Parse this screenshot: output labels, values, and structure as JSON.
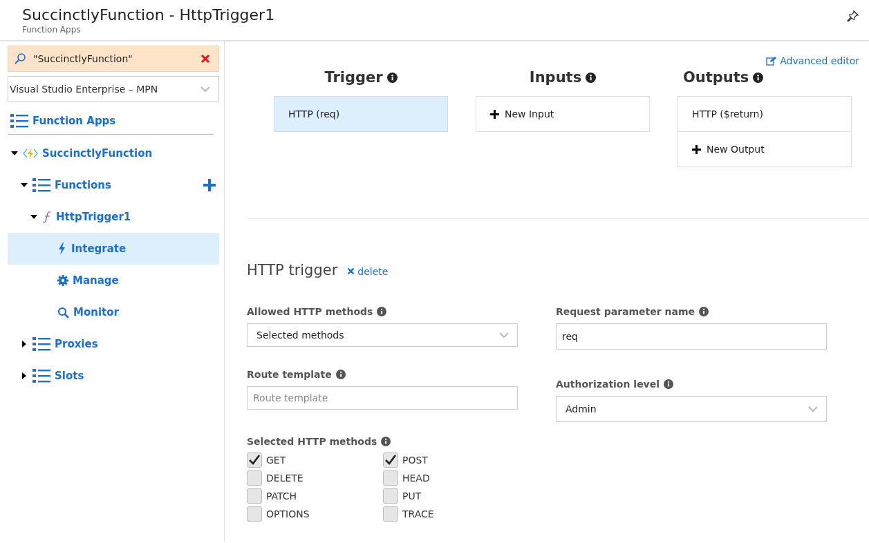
{
  "header": {
    "title": "SuccinctlyFunction - HttpTrigger1",
    "subtitle": "Function Apps"
  },
  "sidebar": {
    "search": {
      "value": "\"SuccinctlyFunction\""
    },
    "subscription": "Visual Studio Enterprise – MPN",
    "root": {
      "label": "Function Apps"
    },
    "tree": [
      {
        "label": "SuccinctlyFunction",
        "kind": "app",
        "expanded": true,
        "selected": false,
        "children": [
          {
            "label": "Functions",
            "kind": "list",
            "expanded": true,
            "selected": false,
            "add": true,
            "children": [
              {
                "label": "HttpTrigger1",
                "kind": "function",
                "expanded": true,
                "selected": false,
                "children": [
                  {
                    "label": "Integrate",
                    "kind": "bolt",
                    "selected": true
                  },
                  {
                    "label": "Manage",
                    "kind": "gear",
                    "selected": false
                  },
                  {
                    "label": "Monitor",
                    "kind": "search",
                    "selected": false
                  }
                ]
              }
            ]
          },
          {
            "label": "Proxies",
            "kind": "list",
            "expanded": false,
            "selected": false
          },
          {
            "label": "Slots",
            "kind": "list",
            "expanded": false,
            "selected": false
          }
        ]
      }
    ]
  },
  "advanced_editor": "Advanced editor",
  "bindings": [
    {
      "title": "Trigger",
      "items": [
        {
          "label": "HTTP (req)",
          "kind": "binding",
          "selected": true
        }
      ]
    },
    {
      "title": "Inputs",
      "items": [
        {
          "label": "New Input",
          "kind": "new",
          "selected": false
        }
      ]
    },
    {
      "title": "Outputs",
      "items": [
        {
          "label": "HTTP ($return)",
          "kind": "binding",
          "selected": false
        },
        {
          "label": "New Output",
          "kind": "new",
          "selected": false
        }
      ]
    }
  ],
  "detail": {
    "title": "HTTP trigger",
    "delete": "delete",
    "allowed_methods": {
      "label": "Allowed HTTP methods",
      "value": "Selected methods"
    },
    "request_param": {
      "label": "Request parameter name",
      "value": "req"
    },
    "route_template": {
      "label": "Route template",
      "placeholder": "Route template"
    },
    "auth_level": {
      "label": "Authorization level",
      "value": "Admin"
    },
    "selected_methods": {
      "label": "Selected HTTP methods",
      "methods": [
        {
          "label": "GET",
          "checked": true
        },
        {
          "label": "POST",
          "checked": true
        },
        {
          "label": "DELETE",
          "checked": false
        },
        {
          "label": "HEAD",
          "checked": false
        },
        {
          "label": "PATCH",
          "checked": false
        },
        {
          "label": "PUT",
          "checked": false
        },
        {
          "label": "OPTIONS",
          "checked": false
        },
        {
          "label": "TRACE",
          "checked": false
        }
      ]
    }
  }
}
